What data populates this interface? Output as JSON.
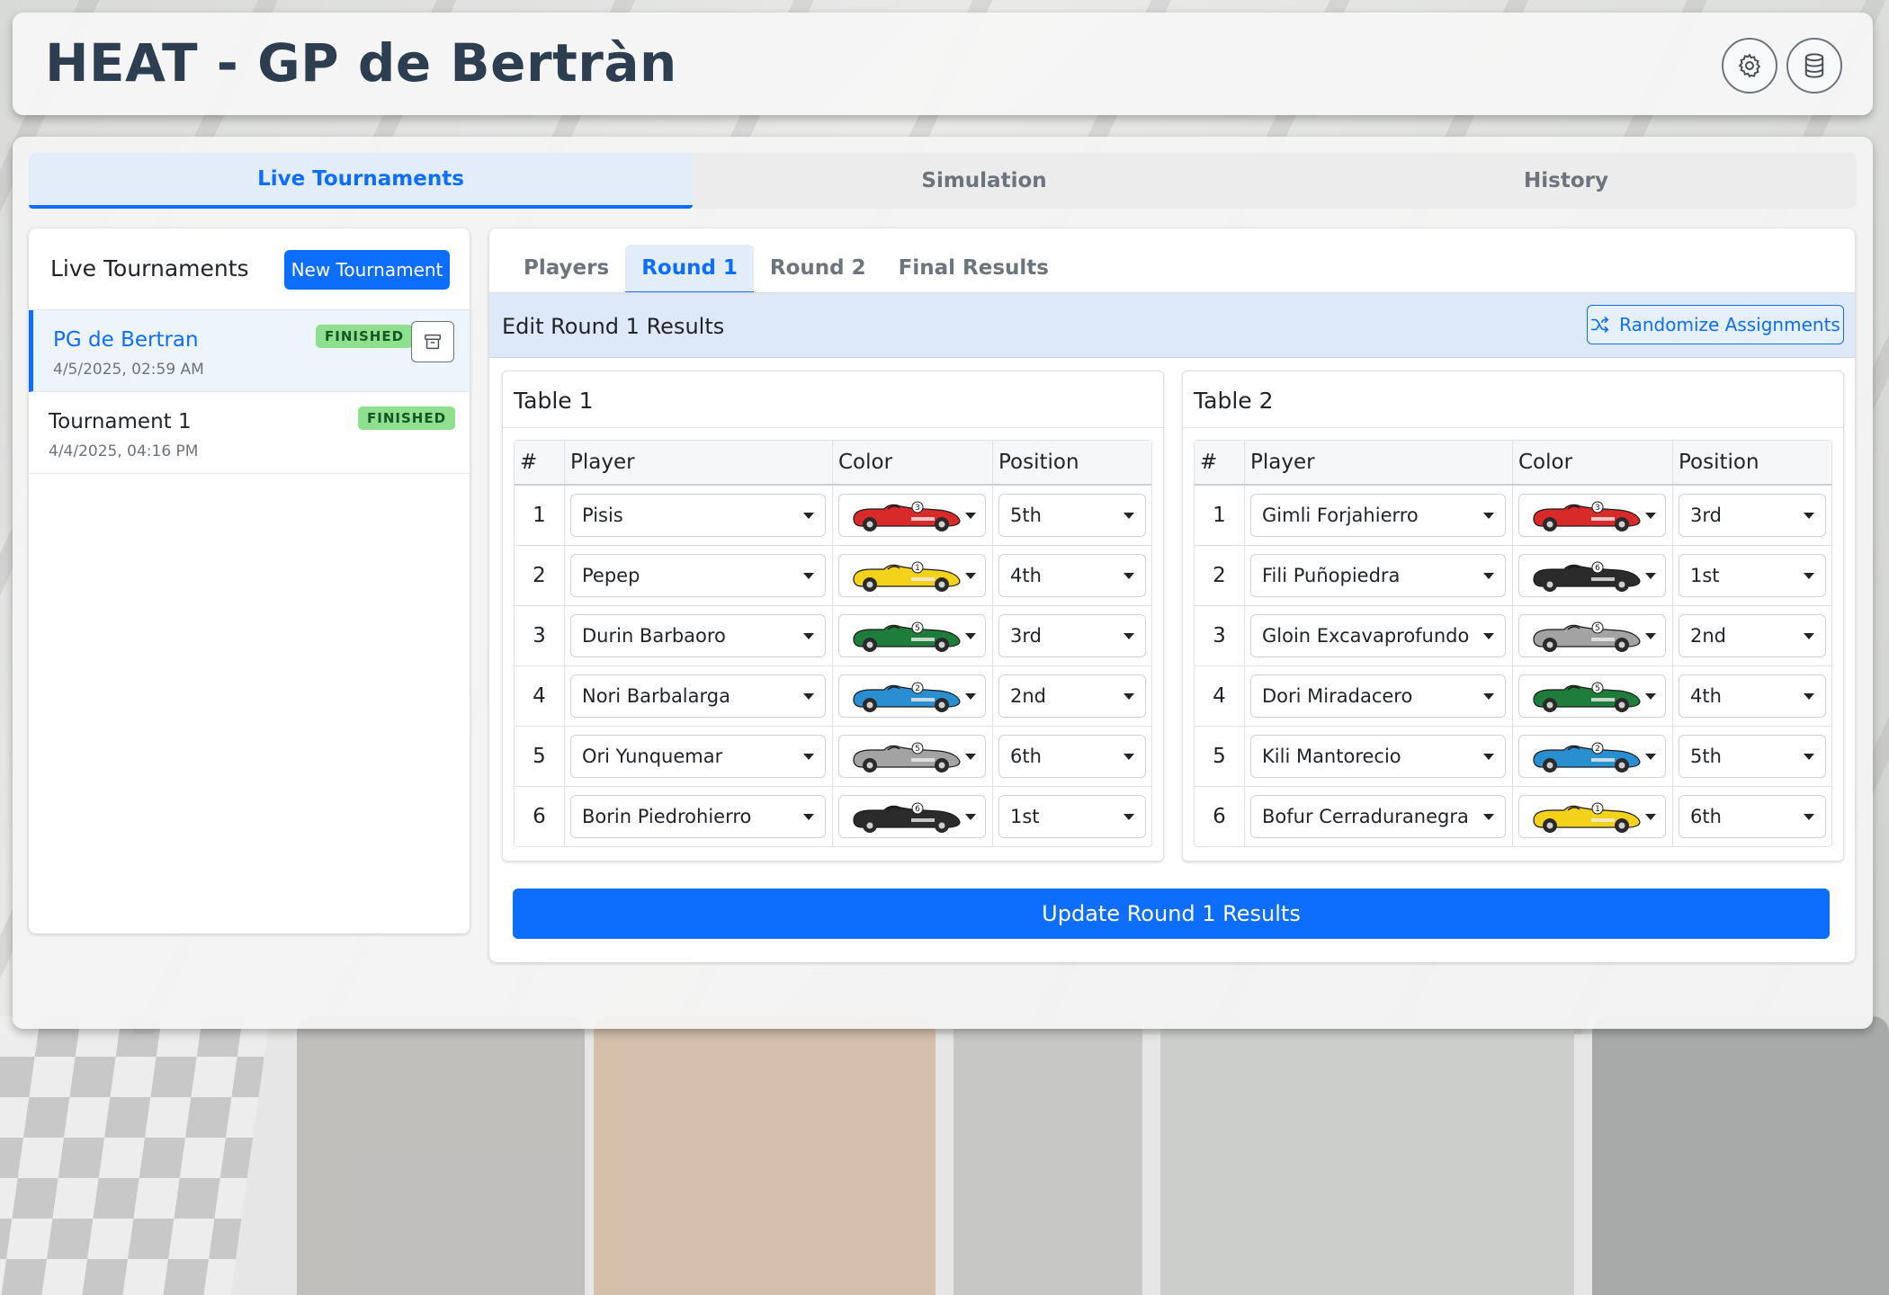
{
  "app": {
    "title": "HEAT - GP de Bertràn"
  },
  "header": {
    "settings_icon": "gear-icon",
    "database_icon": "database-icon"
  },
  "tabs": [
    {
      "label": "Live Tournaments",
      "active": true
    },
    {
      "label": "Simulation",
      "active": false
    },
    {
      "label": "History",
      "active": false
    }
  ],
  "sidebar": {
    "title": "Live Tournaments",
    "new_button": "New Tournament",
    "tournaments": [
      {
        "name": "PG de Bertran",
        "date": "4/5/2025, 02:59 AM",
        "status": "FINISHED",
        "active": true
      },
      {
        "name": "Tournament 1",
        "date": "4/4/2025, 04:16 PM",
        "status": "FINISHED",
        "active": false
      }
    ]
  },
  "subtabs": [
    {
      "label": "Players",
      "active": false
    },
    {
      "label": "Round 1",
      "active": true
    },
    {
      "label": "Round 2",
      "active": false
    },
    {
      "label": "Final Results",
      "active": false
    }
  ],
  "edit": {
    "title": "Edit Round 1 Results",
    "randomize_button": "Randomize Assignments",
    "update_button": "Update Round 1 Results"
  },
  "columns": {
    "num": "#",
    "player": "Player",
    "color": "Color",
    "position": "Position"
  },
  "car_colors": {
    "red": {
      "body": "#d92a2a",
      "number": "3"
    },
    "yellow": {
      "body": "#f2d21b",
      "number": "1"
    },
    "green": {
      "body": "#1e7d3a",
      "number": "5"
    },
    "blue": {
      "body": "#2a8fd0",
      "number": "2"
    },
    "gray": {
      "body": "#a3a3a3",
      "number": "5"
    },
    "black": {
      "body": "#2b2b2b",
      "number": "6"
    }
  },
  "tables": [
    {
      "title": "Table 1",
      "rows": [
        {
          "num": "1",
          "player": "Pisis",
          "color": "red",
          "position": "5th"
        },
        {
          "num": "2",
          "player": "Pepep",
          "color": "yellow",
          "position": "4th"
        },
        {
          "num": "3",
          "player": "Durin Barbaoro",
          "color": "green",
          "position": "3rd"
        },
        {
          "num": "4",
          "player": "Nori Barbalarga",
          "color": "blue",
          "position": "2nd"
        },
        {
          "num": "5",
          "player": "Ori Yunquemar",
          "color": "gray",
          "position": "6th"
        },
        {
          "num": "6",
          "player": "Borin Piedrohierro",
          "color": "black",
          "position": "1st"
        }
      ]
    },
    {
      "title": "Table 2",
      "rows": [
        {
          "num": "1",
          "player": "Gimli Forjahierro",
          "color": "red",
          "position": "3rd"
        },
        {
          "num": "2",
          "player": "Fili Puñopiedra",
          "color": "black",
          "position": "1st"
        },
        {
          "num": "3",
          "player": "Gloin Excavaprofundo",
          "color": "gray",
          "position": "2nd"
        },
        {
          "num": "4",
          "player": "Dori Miradacero",
          "color": "green",
          "position": "4th"
        },
        {
          "num": "5",
          "player": "Kili Mantorecio",
          "color": "blue",
          "position": "5th"
        },
        {
          "num": "6",
          "player": "Bofur Cerraduranegra",
          "color": "yellow",
          "position": "6th"
        }
      ]
    }
  ]
}
